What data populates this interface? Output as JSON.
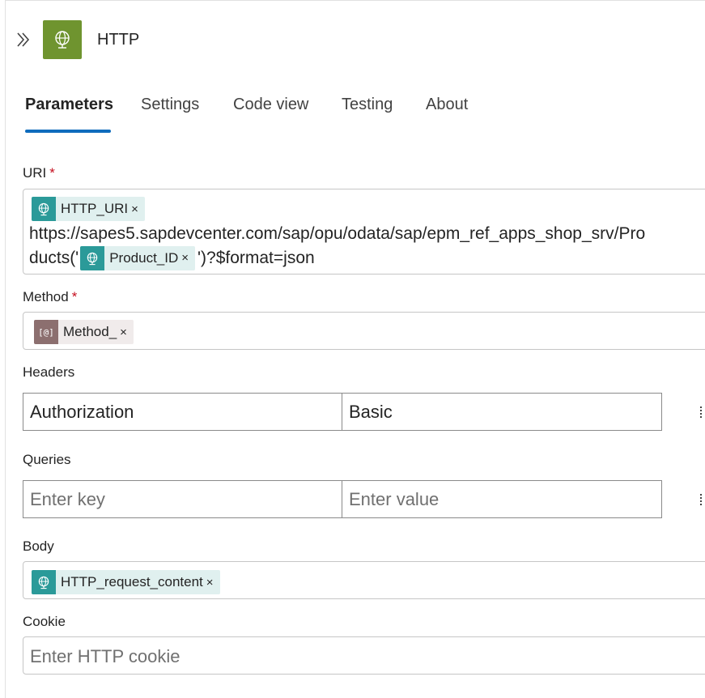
{
  "header": {
    "title": "HTTP"
  },
  "tabs": [
    {
      "label": "Parameters"
    },
    {
      "label": "Settings"
    },
    {
      "label": "Code view"
    },
    {
      "label": "Testing"
    },
    {
      "label": "About"
    }
  ],
  "uri": {
    "label": "URI",
    "required_mark": "*",
    "token_http_uri": "HTTP_URI",
    "text_line1": "https://sapes5.sapdevcenter.com/sap/opu/odata/sap/epm_ref_apps_shop_srv/Pro",
    "text_line2_prefix": "ducts('",
    "token_product_id": "Product_ID",
    "text_line2_suffix": "')?$format=json"
  },
  "method": {
    "label": "Method",
    "required_mark": "*",
    "token_icon_text": "[@]",
    "token": "Method_"
  },
  "headers": {
    "label": "Headers",
    "key": "Authorization",
    "value": "Basic"
  },
  "queries": {
    "label": "Queries",
    "key_placeholder": "Enter key",
    "value_placeholder": "Enter value"
  },
  "body": {
    "label": "Body",
    "token": "HTTP_request_content"
  },
  "cookie": {
    "label": "Cookie",
    "placeholder": "Enter HTTP cookie"
  },
  "token_remove_glyph": "×",
  "colors": {
    "accent": "#0f6cbd",
    "http_icon_bg": "#6f942f",
    "token_icon_bg": "#2b9a99",
    "required": "#c50f1f"
  }
}
